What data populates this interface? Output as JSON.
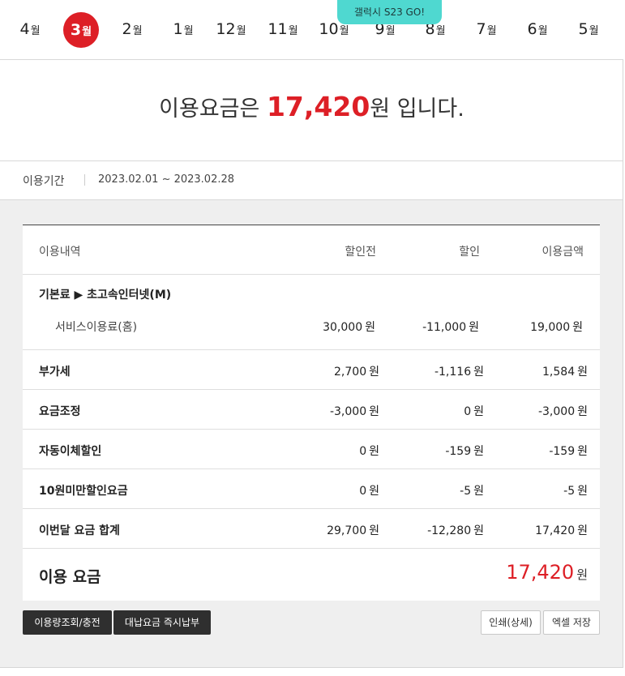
{
  "promo": {
    "text": "갤럭시 S23 GO!"
  },
  "months": [
    {
      "num": "4",
      "unit": "월"
    },
    {
      "num": "3",
      "unit": "월",
      "active": true
    },
    {
      "num": "2",
      "unit": "월"
    },
    {
      "num": "1",
      "unit": "월"
    },
    {
      "num": "12",
      "unit": "월"
    },
    {
      "num": "11",
      "unit": "월"
    },
    {
      "num": "10",
      "unit": "월"
    },
    {
      "num": "9",
      "unit": "월"
    },
    {
      "num": "8",
      "unit": "월"
    },
    {
      "num": "7",
      "unit": "월"
    },
    {
      "num": "6",
      "unit": "월"
    },
    {
      "num": "5",
      "unit": "월"
    }
  ],
  "summary": {
    "prefix": "이용요금은 ",
    "amount": "17,420",
    "suffix": "원 입니다."
  },
  "period": {
    "label": "이용기간",
    "range": "2023.02.01 ~ 2023.02.28"
  },
  "table": {
    "headers": {
      "item": "이용내역",
      "before": "할인전",
      "discount": "할인",
      "amount": "이용금액"
    },
    "group": {
      "title": "기본료 ▶ 초고속인터넷(M)",
      "sub_name": "서비스이용료(홈)",
      "before": "30,000",
      "discount": "-11,000",
      "amount": "19,000"
    },
    "rows": [
      {
        "name": "부가세",
        "before": "2,700",
        "discount": "-1,116",
        "amount": "1,584"
      },
      {
        "name": "요금조정",
        "before": "-3,000",
        "discount": "0",
        "amount": "-3,000"
      },
      {
        "name": "자동이체할인",
        "before": "0",
        "discount": "-159",
        "amount": "-159"
      },
      {
        "name": "10원미만할인요금",
        "before": "0",
        "discount": "-5",
        "amount": "-5"
      },
      {
        "name": "이번달 요금 합계",
        "before": "29,700",
        "discount": "-12,280",
        "amount": "17,420"
      }
    ],
    "total": {
      "label": "이용 요금",
      "amount": "17,420"
    },
    "unit": "원"
  },
  "buttons": {
    "usage": "이용량조회/충전",
    "pay": "대납요금 즉시납부",
    "print": "인쇄(상세)",
    "excel": "엑셀 저장"
  },
  "colors": {
    "accent": "#dd1f26",
    "promo": "#4fd8d0",
    "dark_button": "#2f2f2f"
  }
}
